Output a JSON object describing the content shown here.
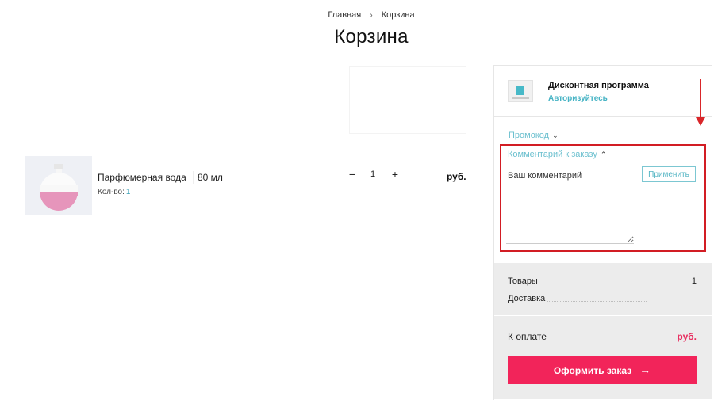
{
  "breadcrumb": {
    "home": "Главная",
    "separator": "›",
    "current": "Корзина"
  },
  "page_title": "Корзина",
  "cart_item": {
    "name": "Парфюмерная вода",
    "volume": "80 мл",
    "qty_label": "Кол-во:",
    "qty_value": "1",
    "stepper": {
      "minus": "−",
      "value": "1",
      "plus": "+"
    },
    "price": "руб."
  },
  "summary": {
    "discount": {
      "title": "Дисконтная программа",
      "login_link": "Авторизуйтесь"
    },
    "promo_label": "Промокод",
    "comment_label": "Комментарий к заказу",
    "comment_placeholder": "Ваш комментарий",
    "apply_label": "Применить",
    "goods_label": "Товары",
    "goods_count": "1",
    "delivery_label": "Доставка",
    "pay_label": "К оплате",
    "pay_value": "руб.",
    "checkout_label": "Оформить заказ",
    "checkout_arrow": "→"
  },
  "colors": {
    "accent": "#f2245a",
    "link": "#45b3c4",
    "highlight": "#d21d24"
  }
}
